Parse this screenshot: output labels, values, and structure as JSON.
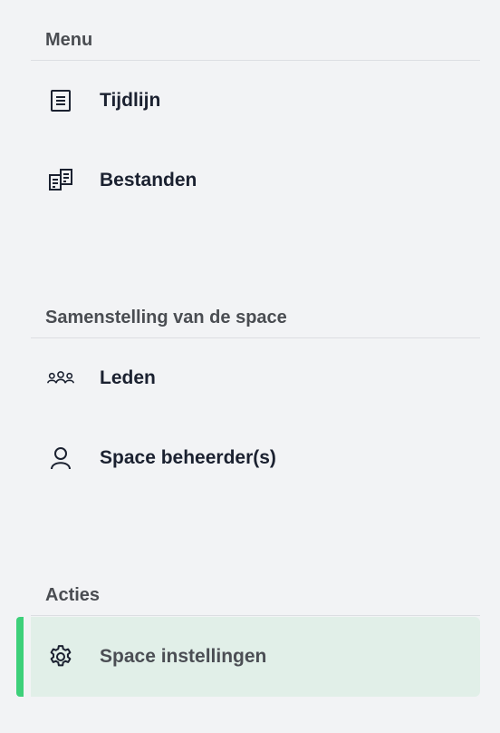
{
  "sections": [
    {
      "title": "Menu",
      "items": [
        {
          "label": "Tijdlijn",
          "icon": "document-list-icon"
        },
        {
          "label": "Bestanden",
          "icon": "files-icon"
        }
      ]
    },
    {
      "title": "Samenstelling van de space",
      "items": [
        {
          "label": "Leden",
          "icon": "users-group-icon"
        },
        {
          "label": "Space beheerder(s)",
          "icon": "user-icon"
        }
      ]
    },
    {
      "title": "Acties",
      "items": [
        {
          "label": "Space instellingen",
          "icon": "gear-icon",
          "active": true
        }
      ]
    }
  ],
  "colors": {
    "background": "#f2f3f5",
    "active_background": "#e1efe8",
    "active_accent": "#3ed07a",
    "text_dark": "#1b2130",
    "section_title": "#4a4d52"
  }
}
